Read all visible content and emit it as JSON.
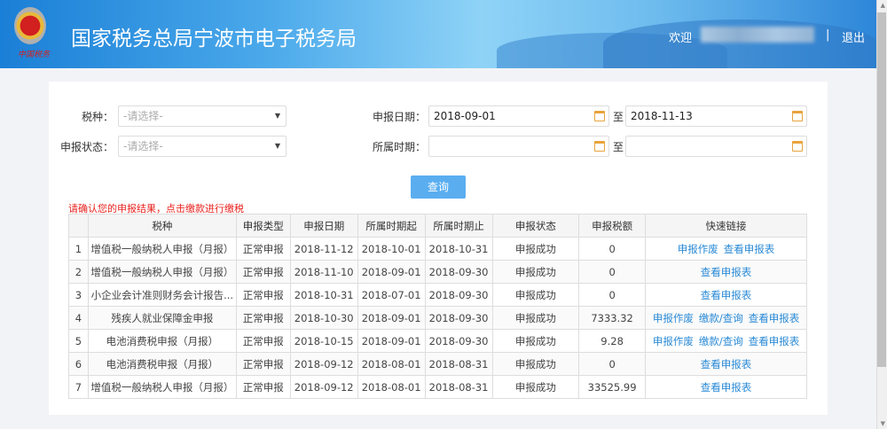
{
  "header": {
    "title": "国家税务总局宁波市电子税务局",
    "seal_text": "中国税务",
    "welcome": "欢迎",
    "separator": "|",
    "logout": "退出"
  },
  "form": {
    "tax_type_label": "税种：",
    "tax_type_placeholder": "-请选择-",
    "status_label": "申报状态：",
    "status_placeholder": "-请选择-",
    "date_label": "申报日期：",
    "date_from": "2018-09-01",
    "to": "至",
    "date_to": "2018-11-13",
    "period_label": "所属时期：",
    "period_from": "",
    "period_to": "",
    "query": "查询"
  },
  "note": "请确认您的申报结果，点击缴款进行缴税",
  "table": {
    "headers": [
      "",
      "税种",
      "申报类型",
      "申报日期",
      "所属时期起",
      "所属时期止",
      "申报状态",
      "申报税额",
      "快速链接"
    ],
    "rows": [
      {
        "no": "1",
        "name": "增值税一般纳税人申报（月报）",
        "type": "正常申报",
        "date": "2018-11-12",
        "from": "2018-10-01",
        "to": "2018-10-31",
        "status": "申报成功",
        "amount": "0",
        "links": [
          "申报作废",
          "查看申报表"
        ]
      },
      {
        "no": "2",
        "name": "增值税一般纳税人申报（月报）",
        "type": "正常申报",
        "date": "2018-11-10",
        "from": "2018-09-01",
        "to": "2018-09-30",
        "status": "申报成功",
        "amount": "0",
        "links": [
          "查看申报表"
        ]
      },
      {
        "no": "3",
        "name": "小企业会计准则财务会计报告...",
        "type": "正常申报",
        "date": "2018-10-31",
        "from": "2018-07-01",
        "to": "2018-09-30",
        "status": "申报成功",
        "amount": "0",
        "links": [
          "查看申报表"
        ]
      },
      {
        "no": "4",
        "name": "残疾人就业保障金申报",
        "type": "正常申报",
        "date": "2018-10-30",
        "from": "2018-09-01",
        "to": "2018-09-30",
        "status": "申报成功",
        "amount": "7333.32",
        "links": [
          "申报作废",
          "缴款/查询",
          "查看申报表"
        ]
      },
      {
        "no": "5",
        "name": "电池消费税申报（月报）",
        "type": "正常申报",
        "date": "2018-10-15",
        "from": "2018-09-01",
        "to": "2018-09-30",
        "status": "申报成功",
        "amount": "9.28",
        "links": [
          "申报作废",
          "缴款/查询",
          "查看申报表"
        ]
      },
      {
        "no": "6",
        "name": "电池消费税申报（月报）",
        "type": "正常申报",
        "date": "2018-09-12",
        "from": "2018-08-01",
        "to": "2018-08-31",
        "status": "申报成功",
        "amount": "0",
        "links": [
          "查看申报表"
        ]
      },
      {
        "no": "7",
        "name": "增值税一般纳税人申报（月报）",
        "type": "正常申报",
        "date": "2018-09-12",
        "from": "2018-08-01",
        "to": "2018-08-31",
        "status": "申报成功",
        "amount": "33525.99",
        "links": [
          "查看申报表"
        ]
      }
    ]
  }
}
